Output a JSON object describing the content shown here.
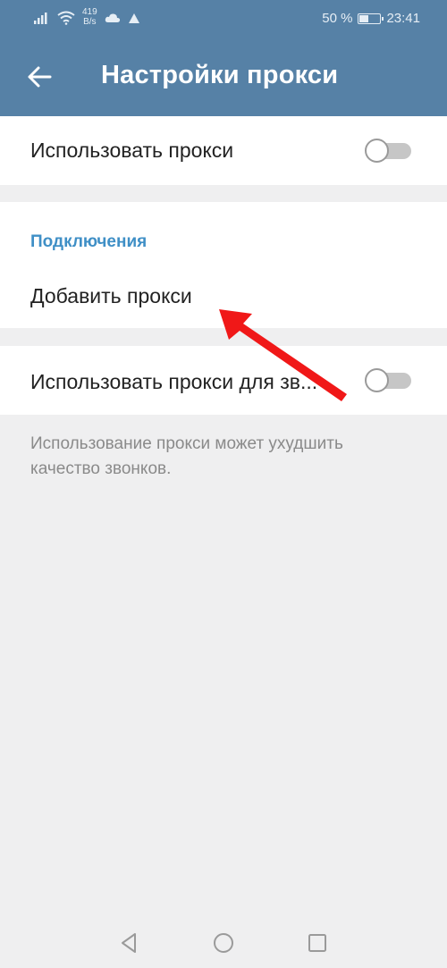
{
  "status_bar": {
    "net_speed_value": "419",
    "net_speed_unit": "B/s",
    "battery_text": "50 %",
    "battery_level": 0.5,
    "time": "23:41"
  },
  "header": {
    "title": "Настройки прокси"
  },
  "settings": {
    "use_proxy_label": "Использовать прокси",
    "use_proxy_enabled": false,
    "connections_header": "Подключения",
    "add_proxy_label": "Добавить прокси",
    "use_proxy_calls_label": "Использовать прокси для зв...",
    "use_proxy_calls_enabled": false,
    "calls_hint": "Использование прокси может ухудшить качество звонков."
  },
  "colors": {
    "header_bg": "#5681a6",
    "accent": "#3f8fc6",
    "annotation_arrow": "#f01818"
  },
  "icons": {
    "back": "arrow-left-icon",
    "nav_back": "triangle-back-icon",
    "nav_home": "circle-home-icon",
    "nav_recent": "square-recents-icon"
  }
}
